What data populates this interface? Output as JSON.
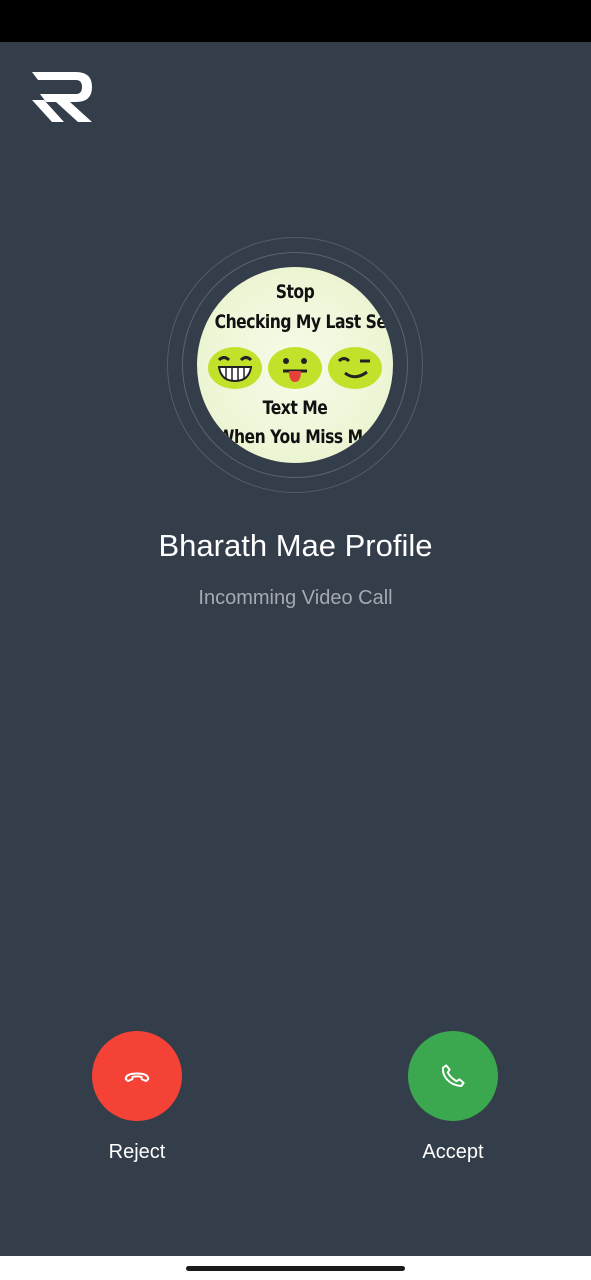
{
  "app": {
    "logo_icon": "r-logo-icon"
  },
  "caller": {
    "name": "Bharath Mae Profile",
    "status": "Incomming Video Call",
    "avatar": {
      "line1": "Stop",
      "line2": "Checking My Last Seen",
      "line3": "Text Me",
      "line4": "When You Miss Me"
    }
  },
  "actions": {
    "reject_label": "Reject",
    "accept_label": "Accept",
    "reject_color": "#f44336",
    "accept_color": "#3ba84f"
  },
  "colors": {
    "background": "#343d4a",
    "status_bar": "#000000"
  }
}
